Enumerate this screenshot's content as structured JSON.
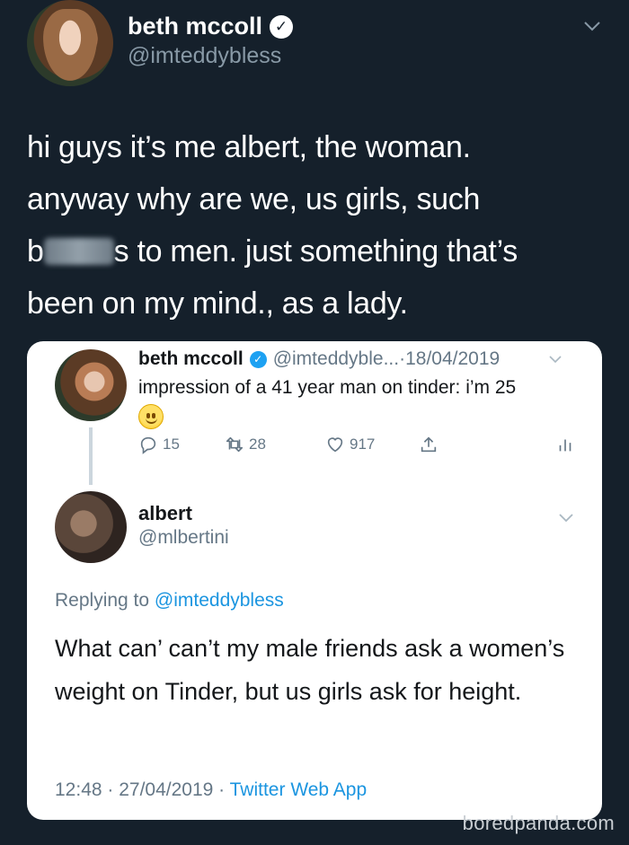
{
  "outer_tweet": {
    "name": "beth mccoll",
    "handle": "@imteddybless",
    "text_line1": "hi guys it’s me albert, the woman.",
    "text_line2": "anyway why are we, us girls, such",
    "text_line3_start": "b",
    "text_line3_end": "s to men. just something that’s",
    "text_line4": "been on my mind., as a lady."
  },
  "quoted_tweet": {
    "name": "beth mccoll",
    "handle_truncated": "@imteddyble...",
    "separator": " · ",
    "date": "18/04/2019",
    "text": "impression of a 41 year man on tinder: i’m 25",
    "actions": {
      "replies": "15",
      "retweets": "28",
      "likes": "917"
    }
  },
  "reply_tweet": {
    "name": "albert",
    "handle": "@mlbertini",
    "replying_prefix": "Replying to ",
    "replying_to": "@imteddybless",
    "text": "What can’ can’t my male friends ask a women’s weight on Tinder, but us girls ask for height.",
    "time": "12:48",
    "date": "27/04/2019",
    "via": "Twitter Web App"
  },
  "watermark": "boredpanda.com",
  "colors": {
    "background": "#15202b",
    "accent": "#1b95e0",
    "muted": "#657786"
  }
}
